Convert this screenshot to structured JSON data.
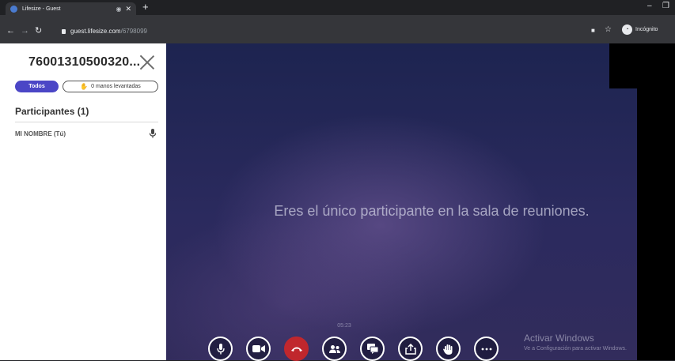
{
  "browser": {
    "tab": {
      "title": "Lifesize - Guest",
      "audio_icon": "audio-indicator-icon",
      "close_icon": "close-icon"
    },
    "new_tab_label": "+",
    "window_controls": {
      "minimize": "–",
      "restore": "❐"
    },
    "url": {
      "host": "guest.lifesize.com",
      "path": "/6798099"
    },
    "incognito_label": "Incógnito"
  },
  "panel": {
    "meeting_id": "76001310500320...",
    "filters": {
      "all": "Todos",
      "raised_hands": "0 manos levantadas"
    },
    "participants_title": "Participantes (1)",
    "participants": [
      {
        "name": "MI NOMBRE (Tú)",
        "mic": "microphone-icon"
      }
    ]
  },
  "stage": {
    "empty_message": "Eres el único participante en la sala de reuniones.",
    "timer": "05:23",
    "controls": [
      "microphone",
      "camera",
      "hang-up",
      "participants",
      "chat",
      "share",
      "raise-hand",
      "more"
    ]
  },
  "windows_activation": {
    "title": "Activar Windows",
    "subtitle": "Ve a Configuración para activar Windows."
  },
  "colors": {
    "accent": "#4b46c6",
    "hangup": "#c0272d",
    "stage": "#2b2a5e"
  }
}
